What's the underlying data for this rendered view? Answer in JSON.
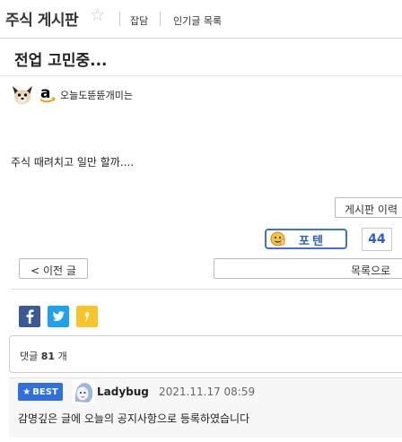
{
  "header": {
    "board_title": "주식 게시판",
    "favorite_icon": "star-outline-icon",
    "nav": [
      {
        "label": "잡담"
      },
      {
        "label": "인기글 목록"
      }
    ]
  },
  "post": {
    "title": "전업 고민중...",
    "author": {
      "name": "오늘도뜐뜐개미는",
      "icons": [
        "dog-face-icon",
        "amazon-logo-icon"
      ]
    },
    "body": "주식 때려치고 일만 할까....",
    "history_button": "게시판 이력",
    "potential": {
      "label": "포텐",
      "count": "44"
    }
  },
  "actions": {
    "prev_label": "< 이전 글",
    "list_label": "목록으로"
  },
  "share": [
    {
      "icon": "facebook-icon",
      "color": "#3b5998"
    },
    {
      "icon": "twitter-icon",
      "color": "#1da1f2"
    },
    {
      "icon": "kakao-talk-icon",
      "color": "#f9c32a"
    }
  ],
  "comments": {
    "label_prefix": "댓글",
    "count": "81",
    "label_suffix": "개",
    "best": [
      {
        "badge": "BEST",
        "author": "Ladybug",
        "time": "2021.11.17 08:59",
        "text": "감명깊은 글에 오늘의 공지사항으로 등록하였습니다"
      }
    ]
  },
  "colors": {
    "accent": "#2f6fdf",
    "border": "#cccccc"
  }
}
